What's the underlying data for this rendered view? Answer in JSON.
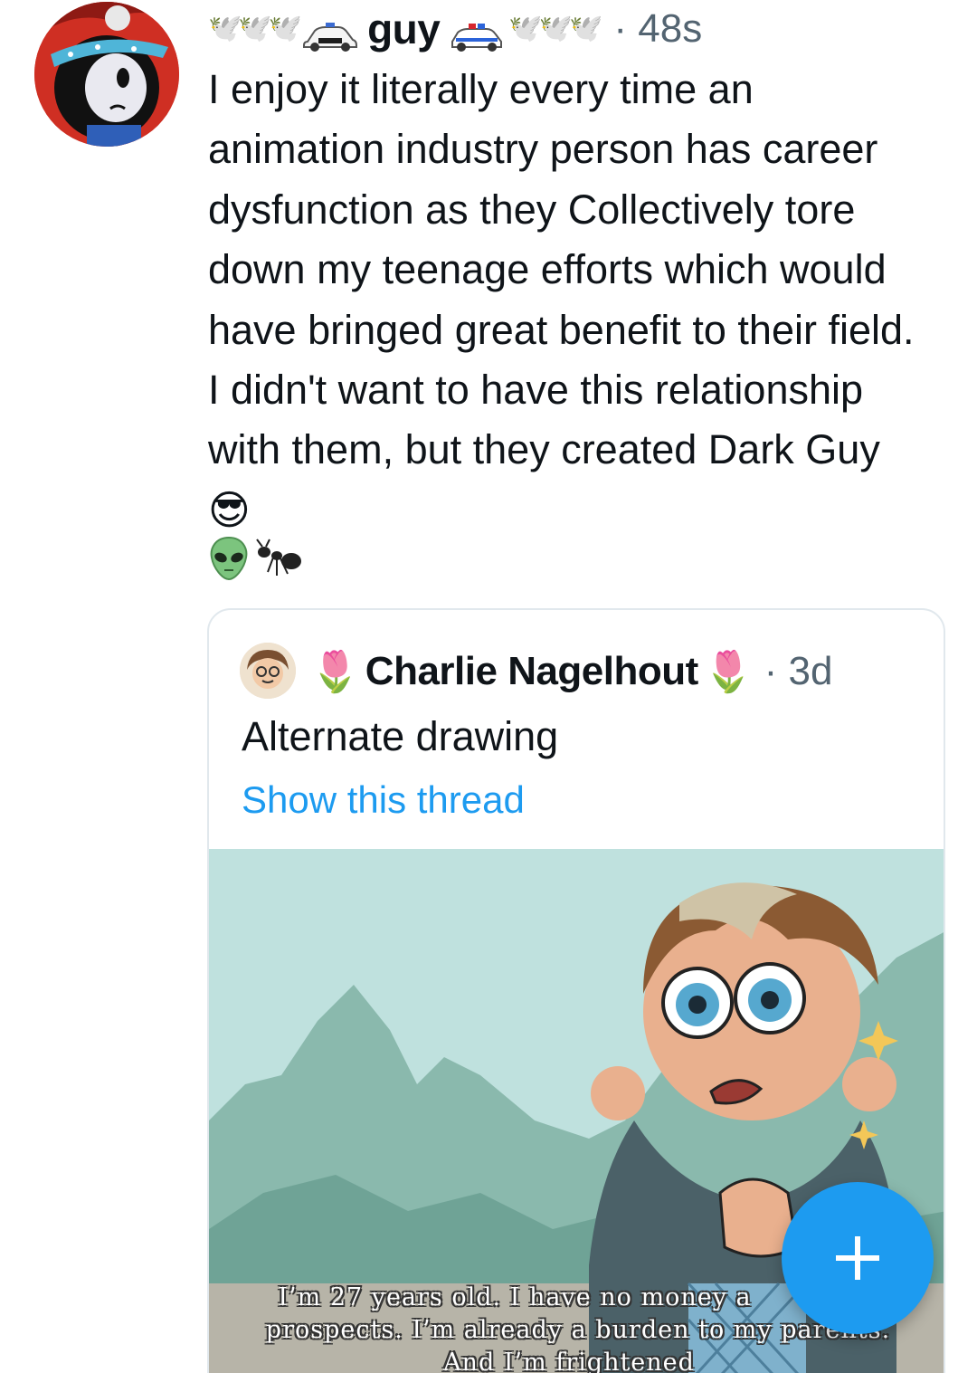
{
  "post": {
    "display_name": "guy",
    "time": "48s",
    "body": "I enjoy it literally every time an animation industry person has career dysfunction as they Collectively tore down my teenage efforts which would have bringed great benefit to their field. I didn't want to have this relationship with them, but they created Dark Guy",
    "inline_emoji": "😎",
    "trailing_emojis": [
      "👽",
      "🐜"
    ],
    "name_decorations_left": "🕊️🕊️🕊️",
    "name_decorations_right": "🕊️🕊️🕊️",
    "car_label": "POLICE"
  },
  "quoted": {
    "display_name": "Charlie Nagelhout",
    "name_emoji": "🌷",
    "time": "3d",
    "text": "Alternate drawing",
    "link": "Show this thread",
    "subtitle_lines": [
      "I’m 27 years old. I have no money a",
      "prospects. I’m already a burden to my parents.",
      "And I’m frightened"
    ]
  },
  "colors": {
    "accent": "#1d9bf0",
    "muted": "#536471",
    "text": "#0f1419",
    "border": "#e1e8ed"
  },
  "icons": {
    "more": "more-vertical-icon",
    "compose": "plus-icon"
  }
}
